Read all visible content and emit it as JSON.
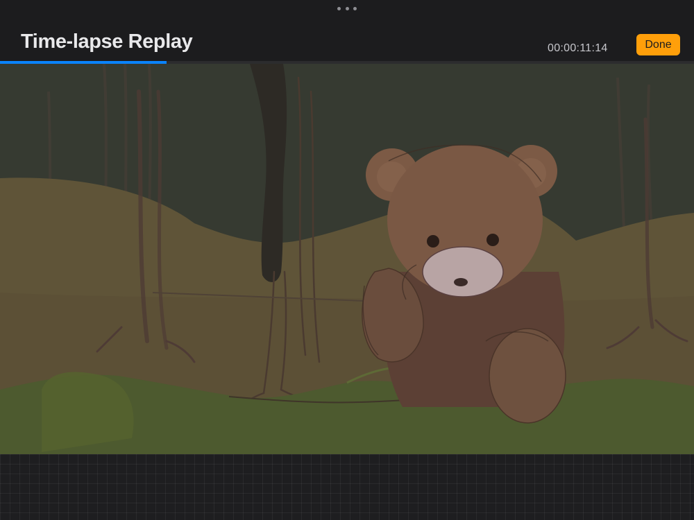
{
  "header": {
    "title": "Time-lapse Replay",
    "timestamp": "00:00:11:14",
    "done_label": "Done",
    "more_icon": "ellipsis-icon"
  },
  "playback": {
    "progress_fraction": 0.24
  },
  "colors": {
    "accent_orange": "#ff9f0a",
    "progress_blue": "#0a84ff",
    "background": "#1c1c1e"
  }
}
